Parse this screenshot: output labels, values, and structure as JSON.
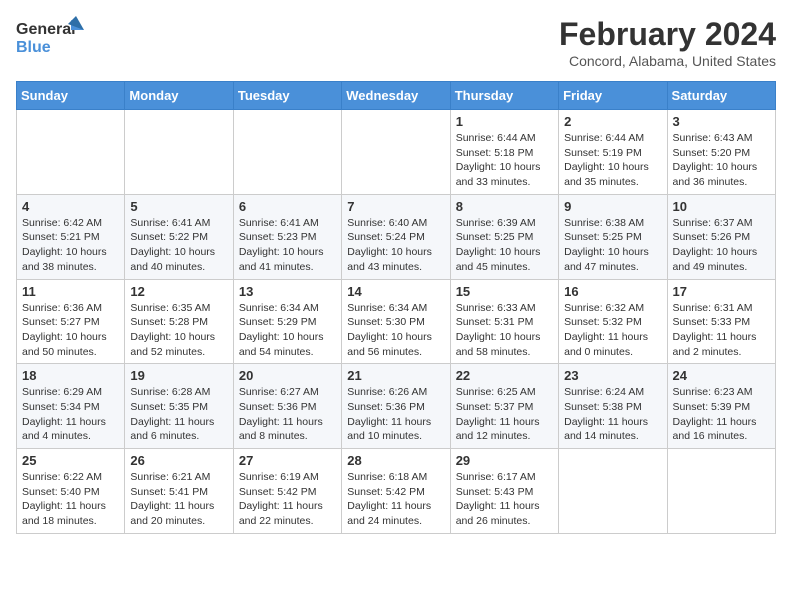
{
  "header": {
    "logo": {
      "line1": "General",
      "line2": "Blue"
    },
    "title": "February 2024",
    "subtitle": "Concord, Alabama, United States"
  },
  "calendar": {
    "days_of_week": [
      "Sunday",
      "Monday",
      "Tuesday",
      "Wednesday",
      "Thursday",
      "Friday",
      "Saturday"
    ],
    "weeks": [
      [
        {
          "day": "",
          "info": ""
        },
        {
          "day": "",
          "info": ""
        },
        {
          "day": "",
          "info": ""
        },
        {
          "day": "",
          "info": ""
        },
        {
          "day": "1",
          "info": "Sunrise: 6:44 AM\nSunset: 5:18 PM\nDaylight: 10 hours\nand 33 minutes."
        },
        {
          "day": "2",
          "info": "Sunrise: 6:44 AM\nSunset: 5:19 PM\nDaylight: 10 hours\nand 35 minutes."
        },
        {
          "day": "3",
          "info": "Sunrise: 6:43 AM\nSunset: 5:20 PM\nDaylight: 10 hours\nand 36 minutes."
        }
      ],
      [
        {
          "day": "4",
          "info": "Sunrise: 6:42 AM\nSunset: 5:21 PM\nDaylight: 10 hours\nand 38 minutes."
        },
        {
          "day": "5",
          "info": "Sunrise: 6:41 AM\nSunset: 5:22 PM\nDaylight: 10 hours\nand 40 minutes."
        },
        {
          "day": "6",
          "info": "Sunrise: 6:41 AM\nSunset: 5:23 PM\nDaylight: 10 hours\nand 41 minutes."
        },
        {
          "day": "7",
          "info": "Sunrise: 6:40 AM\nSunset: 5:24 PM\nDaylight: 10 hours\nand 43 minutes."
        },
        {
          "day": "8",
          "info": "Sunrise: 6:39 AM\nSunset: 5:25 PM\nDaylight: 10 hours\nand 45 minutes."
        },
        {
          "day": "9",
          "info": "Sunrise: 6:38 AM\nSunset: 5:25 PM\nDaylight: 10 hours\nand 47 minutes."
        },
        {
          "day": "10",
          "info": "Sunrise: 6:37 AM\nSunset: 5:26 PM\nDaylight: 10 hours\nand 49 minutes."
        }
      ],
      [
        {
          "day": "11",
          "info": "Sunrise: 6:36 AM\nSunset: 5:27 PM\nDaylight: 10 hours\nand 50 minutes."
        },
        {
          "day": "12",
          "info": "Sunrise: 6:35 AM\nSunset: 5:28 PM\nDaylight: 10 hours\nand 52 minutes."
        },
        {
          "day": "13",
          "info": "Sunrise: 6:34 AM\nSunset: 5:29 PM\nDaylight: 10 hours\nand 54 minutes."
        },
        {
          "day": "14",
          "info": "Sunrise: 6:34 AM\nSunset: 5:30 PM\nDaylight: 10 hours\nand 56 minutes."
        },
        {
          "day": "15",
          "info": "Sunrise: 6:33 AM\nSunset: 5:31 PM\nDaylight: 10 hours\nand 58 minutes."
        },
        {
          "day": "16",
          "info": "Sunrise: 6:32 AM\nSunset: 5:32 PM\nDaylight: 11 hours\nand 0 minutes."
        },
        {
          "day": "17",
          "info": "Sunrise: 6:31 AM\nSunset: 5:33 PM\nDaylight: 11 hours\nand 2 minutes."
        }
      ],
      [
        {
          "day": "18",
          "info": "Sunrise: 6:29 AM\nSunset: 5:34 PM\nDaylight: 11 hours\nand 4 minutes."
        },
        {
          "day": "19",
          "info": "Sunrise: 6:28 AM\nSunset: 5:35 PM\nDaylight: 11 hours\nand 6 minutes."
        },
        {
          "day": "20",
          "info": "Sunrise: 6:27 AM\nSunset: 5:36 PM\nDaylight: 11 hours\nand 8 minutes."
        },
        {
          "day": "21",
          "info": "Sunrise: 6:26 AM\nSunset: 5:36 PM\nDaylight: 11 hours\nand 10 minutes."
        },
        {
          "day": "22",
          "info": "Sunrise: 6:25 AM\nSunset: 5:37 PM\nDaylight: 11 hours\nand 12 minutes."
        },
        {
          "day": "23",
          "info": "Sunrise: 6:24 AM\nSunset: 5:38 PM\nDaylight: 11 hours\nand 14 minutes."
        },
        {
          "day": "24",
          "info": "Sunrise: 6:23 AM\nSunset: 5:39 PM\nDaylight: 11 hours\nand 16 minutes."
        }
      ],
      [
        {
          "day": "25",
          "info": "Sunrise: 6:22 AM\nSunset: 5:40 PM\nDaylight: 11 hours\nand 18 minutes."
        },
        {
          "day": "26",
          "info": "Sunrise: 6:21 AM\nSunset: 5:41 PM\nDaylight: 11 hours\nand 20 minutes."
        },
        {
          "day": "27",
          "info": "Sunrise: 6:19 AM\nSunset: 5:42 PM\nDaylight: 11 hours\nand 22 minutes."
        },
        {
          "day": "28",
          "info": "Sunrise: 6:18 AM\nSunset: 5:42 PM\nDaylight: 11 hours\nand 24 minutes."
        },
        {
          "day": "29",
          "info": "Sunrise: 6:17 AM\nSunset: 5:43 PM\nDaylight: 11 hours\nand 26 minutes."
        },
        {
          "day": "",
          "info": ""
        },
        {
          "day": "",
          "info": ""
        }
      ]
    ]
  }
}
